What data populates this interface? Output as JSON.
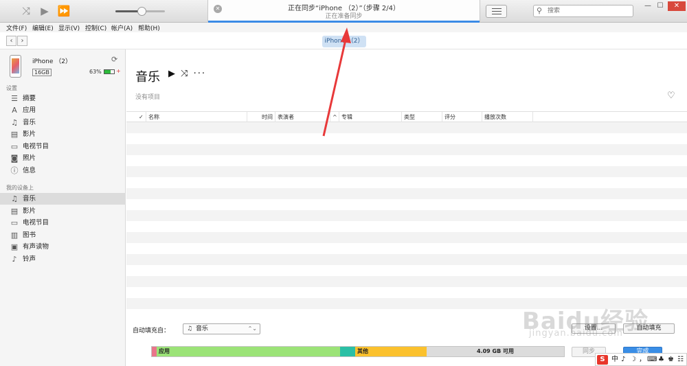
{
  "topbar": {
    "shuffle_glyph": "⤨",
    "play_glyph": "▶",
    "forward_glyph": "⏩",
    "volume_level": 0.5,
    "status_close_glyph": "✕",
    "status_title": "正在同步“iPhone （2）”（步骤 2/4）",
    "status_subtitle": "正在准备同步",
    "sync_progress": 1.0,
    "search_placeholder": "搜索",
    "search_glyph": "⚲",
    "win_min": "—",
    "win_max": "☐",
    "win_close": "✕"
  },
  "menu": [
    {
      "label": "文件(F)"
    },
    {
      "label": "编辑(E)"
    },
    {
      "label": "显示(V)"
    },
    {
      "label": "控制(C)"
    },
    {
      "label": "帐户(A)"
    },
    {
      "label": "帮助(H)"
    }
  ],
  "nav": {
    "back_glyph": "‹",
    "forward_glyph": "›",
    "device_pill": "iPhone （2）"
  },
  "device": {
    "name": "iPhone （2）",
    "capacity": "16GB",
    "battery_text": "63%",
    "battery_level": 0.63,
    "sync_glyph": "⟳",
    "charging_glyph": "+"
  },
  "sidebar": {
    "settings_header": "设置",
    "settings_items": [
      {
        "label": "摘要",
        "icon": "☰"
      },
      {
        "label": "应用",
        "icon": "A"
      },
      {
        "label": "音乐",
        "icon": "♫"
      },
      {
        "label": "影片",
        "icon": "▤"
      },
      {
        "label": "电视节目",
        "icon": "▭"
      },
      {
        "label": "照片",
        "icon": "◙"
      },
      {
        "label": "信息",
        "icon": "ⓘ"
      }
    ],
    "ondevice_header": "我的设备上",
    "ondevice_items": [
      {
        "label": "音乐",
        "icon": "♫"
      },
      {
        "label": "影片",
        "icon": "▤"
      },
      {
        "label": "电视节目",
        "icon": "▭"
      },
      {
        "label": "图书",
        "icon": "▥"
      },
      {
        "label": "有声读物",
        "icon": "▣"
      },
      {
        "label": "铃声",
        "icon": "♪"
      }
    ]
  },
  "main": {
    "title": "音乐",
    "controls": "▶ ⤨ ···",
    "empty_text": "没有项目",
    "heart_glyph": "♡",
    "columns": [
      {
        "label": "✓"
      },
      {
        "label": "名称"
      },
      {
        "label": "时间"
      },
      {
        "label": "表演者"
      },
      {
        "label": "^"
      },
      {
        "label": "专辑"
      },
      {
        "label": "类型"
      },
      {
        "label": "评分"
      },
      {
        "label": "播放次数"
      }
    ],
    "autofill_label": "自动填充自：",
    "autofill_source": "音乐",
    "autofill_icon": "♫",
    "autofill_arrow": "⌃⌄",
    "settings_button": "设置...",
    "autofill_button": "自动填充"
  },
  "storage": {
    "segments": [
      {
        "label": "",
        "color": "#e9758a",
        "fraction": 0.012
      },
      {
        "label": "应用",
        "color": "#9be377",
        "fraction": 0.445
      },
      {
        "label": "",
        "color": "#2bbfa5",
        "fraction": 0.037
      },
      {
        "label": "其他",
        "color": "#fbc12d",
        "fraction": 0.173
      },
      {
        "label": "4.09 GB 可用",
        "color": "#dcdcdc",
        "fraction": 0.333
      }
    ],
    "sync_button": "同步",
    "done_button": "完成"
  },
  "watermark": {
    "main": "Baidu经验",
    "sub": "jingyan.baidu.com"
  },
  "ime": {
    "logo": "S",
    "items": [
      "中",
      "♪",
      "☽",
      "，",
      "⌨",
      "♣",
      "♚",
      "☷"
    ]
  },
  "colors": {
    "accent": "#3b8be6",
    "arrow": "#e8393a",
    "device_pill_bg": "#cfe1f4"
  }
}
